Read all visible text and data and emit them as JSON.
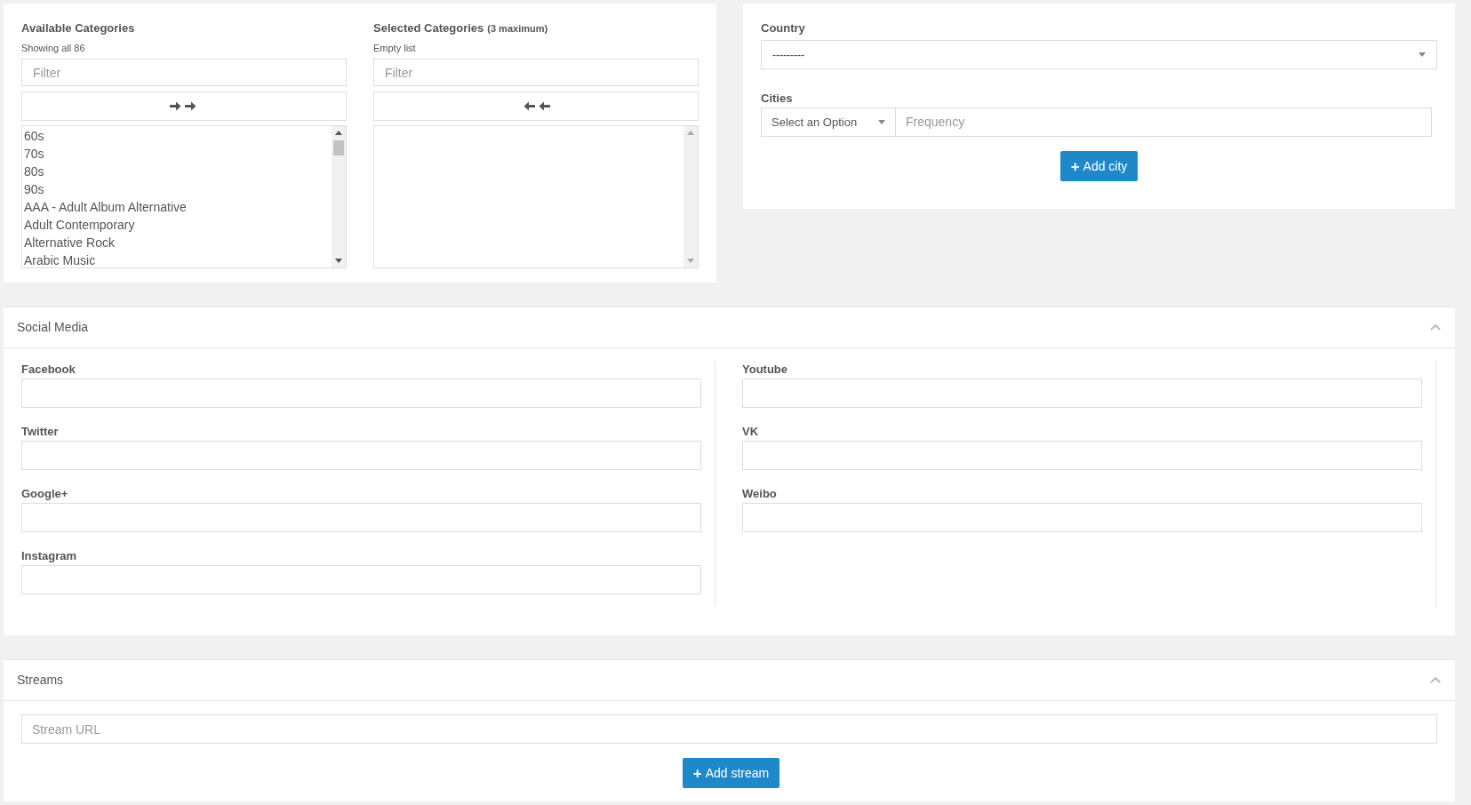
{
  "categories": {
    "available": {
      "label": "Available Categories",
      "info": "Showing all 86",
      "filter_placeholder": "Filter",
      "items": [
        "60s",
        "70s",
        "80s",
        "90s",
        "AAA - Adult Album Alternative",
        "Adult Contemporary",
        "Alternative Rock",
        "Arabic Music"
      ]
    },
    "selected": {
      "label": "Selected Categories",
      "note": "(3 maximum)",
      "info": "Empty list",
      "filter_placeholder": "Filter"
    }
  },
  "location": {
    "country_label": "Country",
    "country_value": "---------",
    "cities_label": "Cities",
    "city_select": "Select an Option",
    "frequency_placeholder": "Frequency",
    "add_button": "Add city",
    "add_icon": "+"
  },
  "social_media": {
    "title": "Social Media",
    "left_fields": [
      {
        "label": "Facebook"
      },
      {
        "label": "Twitter"
      },
      {
        "label": "Google+"
      },
      {
        "label": "Instagram"
      }
    ],
    "right_fields": [
      {
        "label": "Youtube"
      },
      {
        "label": "VK"
      },
      {
        "label": "Weibo"
      }
    ]
  },
  "streams": {
    "title": "Streams",
    "url_placeholder": "Stream URL",
    "add_button": "Add stream",
    "add_icon": "+"
  }
}
